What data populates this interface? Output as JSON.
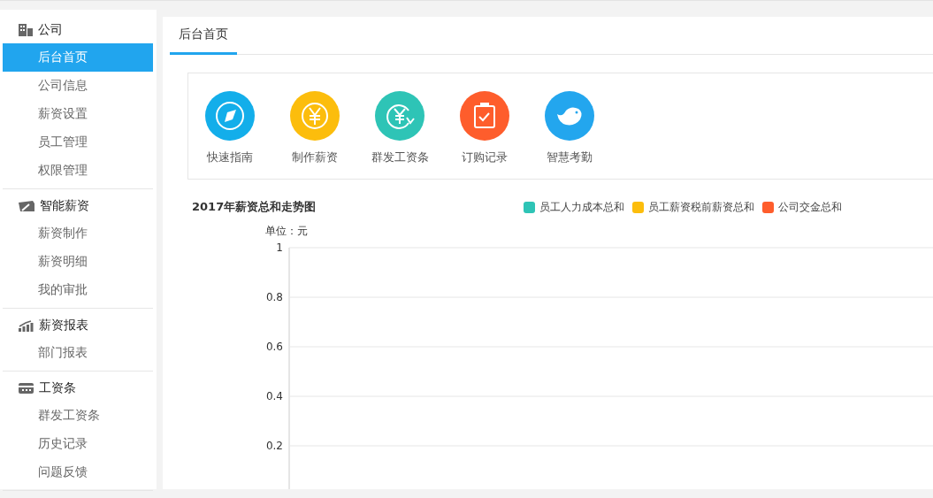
{
  "sidebar": {
    "groups": [
      {
        "title": "公司",
        "kind": "building",
        "items": [
          {
            "label": "后台首页",
            "selected": true
          },
          {
            "label": "公司信息",
            "selected": false
          },
          {
            "label": "薪资设置",
            "selected": false
          },
          {
            "label": "员工管理",
            "selected": false
          },
          {
            "label": "权限管理",
            "selected": false
          }
        ]
      },
      {
        "title": "智能薪资",
        "kind": "wallet",
        "items": [
          {
            "label": "薪资制作",
            "selected": false
          },
          {
            "label": "薪资明细",
            "selected": false
          },
          {
            "label": "我的审批",
            "selected": false
          }
        ]
      },
      {
        "title": "薪资报表",
        "kind": "chart",
        "items": [
          {
            "label": "部门报表",
            "selected": false
          }
        ]
      },
      {
        "title": "工资条",
        "kind": "card",
        "items": [
          {
            "label": "群发工资条",
            "selected": false
          },
          {
            "label": "历史记录",
            "selected": false
          },
          {
            "label": "问题反馈",
            "selected": false
          }
        ]
      }
    ]
  },
  "tabs": [
    {
      "label": "后台首页",
      "selected": true
    }
  ],
  "shortcuts": [
    {
      "label": "快速指南",
      "kind": "compass",
      "color": "#13aeea"
    },
    {
      "label": "制作薪资",
      "kind": "yuan",
      "color": "#fcbd0c"
    },
    {
      "label": "群发工资条",
      "kind": "refund",
      "color": "#2ec4b6"
    },
    {
      "label": "订购记录",
      "kind": "clipboard",
      "color": "#fe5d2c"
    },
    {
      "label": "智慧考勤",
      "kind": "bird",
      "color": "#23a6ee"
    }
  ],
  "chart": {
    "chart_data": {
      "type": "line",
      "title": "2017年薪资总和走势图",
      "ylabel": "单位：元",
      "ylim": [
        0.025,
        1
      ],
      "grid": true,
      "yticks": [
        0.2,
        0.4,
        0.6,
        0.8,
        1
      ],
      "series": [
        {
          "name": "员工人力成本总和",
          "color": "#2ec4b6"
        },
        {
          "name": "员工薪资税前薪资总和",
          "color": "#fcbd0c"
        },
        {
          "name": "公司交金总和",
          "color": "#fe5d2c"
        }
      ]
    }
  }
}
